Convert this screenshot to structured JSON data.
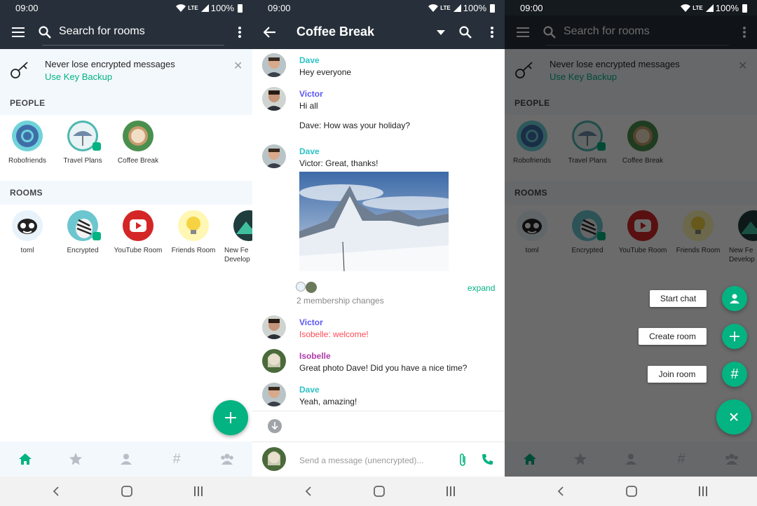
{
  "status": {
    "time": "09:00",
    "network": "LTE",
    "battery": "100%"
  },
  "rooms_list": {
    "search_placeholder": "Search for rooms",
    "banner": {
      "title": "Never lose encrypted messages",
      "action": "Use Key Backup"
    },
    "people_header": "PEOPLE",
    "people": [
      {
        "name": "Robofriends"
      },
      {
        "name": "Travel Plans"
      },
      {
        "name": "Coffee Break"
      }
    ],
    "rooms_header": "ROOMS",
    "rooms": [
      {
        "name": "toml"
      },
      {
        "name": "Encrypted"
      },
      {
        "name": "YouTube Room"
      },
      {
        "name": "Friends Room"
      },
      {
        "name": "New Fe Develop"
      }
    ]
  },
  "chat": {
    "room_name": "Coffee Break",
    "messages": [
      {
        "sender": "Dave",
        "text": "Hey everyone"
      },
      {
        "sender": "Victor",
        "text": "Hi all"
      },
      {
        "sender": "",
        "text": "Dave: How was your holiday?"
      },
      {
        "sender": "Dave",
        "text": "Victor: Great, thanks!"
      },
      {
        "sender": "Victor",
        "text": "Isobelle: welcome!"
      },
      {
        "sender": "Isobelle",
        "text": "Great photo Dave! Did you have a nice time?"
      },
      {
        "sender": "Dave",
        "text": "Yeah, amazing!"
      }
    ],
    "membership": {
      "text": "2 membership changes",
      "expand": "expand"
    },
    "composer_placeholder": "Send a message (unencrypted)..."
  },
  "fab_menu": {
    "start_chat": "Start chat",
    "create_room": "Create room",
    "join_room": "Join room"
  },
  "colors": {
    "toolbar": "#27303a",
    "accent": "#03b381",
    "dave": "#2dc2c5",
    "victor": "#5c56f5",
    "isobelle": "#ac3ba8",
    "highlight": "#ff4b55"
  }
}
